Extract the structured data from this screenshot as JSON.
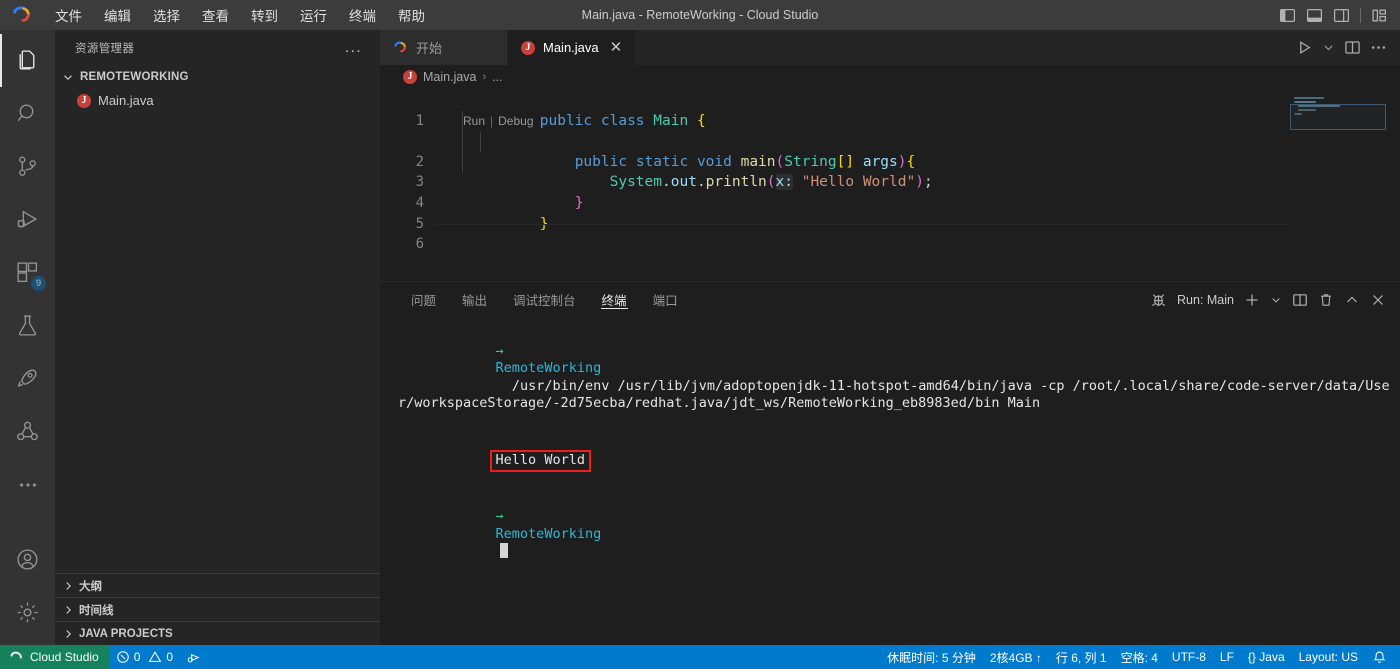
{
  "titlebar": {
    "logo_icon": "cloud-studio-logo-icon",
    "menus": [
      {
        "label": "文件",
        "name": "menu-file"
      },
      {
        "label": "编辑",
        "name": "menu-edit"
      },
      {
        "label": "选择",
        "name": "menu-selection"
      },
      {
        "label": "查看",
        "name": "menu-view"
      },
      {
        "label": "转到",
        "name": "menu-go"
      },
      {
        "label": "运行",
        "name": "menu-run"
      },
      {
        "label": "终端",
        "name": "menu-terminal"
      },
      {
        "label": "帮助",
        "name": "menu-help"
      }
    ],
    "title": "Main.java - RemoteWorking - Cloud Studio",
    "layout_controls": [
      {
        "name": "toggle-primary-sidebar-icon"
      },
      {
        "name": "toggle-panel-icon"
      },
      {
        "name": "toggle-secondary-sidebar-icon"
      },
      {
        "name": "customize-layout-icon"
      }
    ]
  },
  "activitybar": {
    "items": [
      {
        "name": "activity-explorer",
        "icon": "files-icon",
        "active": true,
        "badge": ""
      },
      {
        "name": "activity-search",
        "icon": "search-icon",
        "active": false,
        "badge": ""
      },
      {
        "name": "activity-source-control",
        "icon": "source-control-icon",
        "active": false,
        "badge": ""
      },
      {
        "name": "activity-run-debug",
        "icon": "run-debug-icon",
        "active": false,
        "badge": ""
      },
      {
        "name": "activity-extensions",
        "icon": "extensions-icon",
        "active": false,
        "badge": "9"
      },
      {
        "name": "activity-testing",
        "icon": "beaker-icon",
        "active": false,
        "badge": ""
      },
      {
        "name": "activity-deploy",
        "icon": "rocket-icon",
        "active": false,
        "badge": ""
      },
      {
        "name": "activity-share",
        "icon": "share-nodes-icon",
        "active": false,
        "badge": ""
      },
      {
        "name": "activity-more",
        "icon": "ellipsis-icon",
        "active": false,
        "badge": ""
      }
    ],
    "bottom": [
      {
        "name": "activity-accounts",
        "icon": "account-icon"
      },
      {
        "name": "activity-settings",
        "icon": "gear-icon"
      }
    ]
  },
  "sidebar": {
    "header_title": "资源管理器",
    "more_actions": "...",
    "root_folder": "REMOTEWORKING",
    "files": [
      {
        "name": "Main.java",
        "icon_letter": "J"
      }
    ],
    "sections": [
      {
        "label": "大纲",
        "name": "sidebar-section-outline"
      },
      {
        "label": "时间线",
        "name": "sidebar-section-timeline"
      },
      {
        "label": "JAVA PROJECTS",
        "name": "sidebar-section-java-projects"
      }
    ]
  },
  "editor": {
    "tabs": [
      {
        "label": "开始",
        "name": "tab-welcome",
        "active": false,
        "icon": "cloud-studio-logo-icon",
        "closable": false
      },
      {
        "label": "Main.java",
        "name": "tab-main-java",
        "active": true,
        "icon": "java-file-icon",
        "closable": true
      }
    ],
    "tab_actions": [
      {
        "name": "run-code-button",
        "icon": "play-icon"
      },
      {
        "name": "run-options-chevron-icon",
        "icon": "chevron-down-icon"
      },
      {
        "name": "split-editor-button",
        "icon": "split-editor-icon"
      },
      {
        "name": "editor-more-actions-button",
        "icon": "ellipsis-icon"
      }
    ],
    "breadcrumb": {
      "file": "Main.java",
      "separator": "›",
      "ellipsis": "..."
    },
    "codelens": {
      "run": "Run",
      "divider": "|",
      "debug": "Debug"
    },
    "lines": [
      {
        "number": "1",
        "text": "public class Main {"
      },
      {
        "number": "2",
        "text": "    public static void main(String[] args){"
      },
      {
        "number": "3",
        "text": "        System.out.println(x: \"Hello World\");"
      },
      {
        "number": "4",
        "text": "    }"
      },
      {
        "number": "5",
        "text": "}"
      },
      {
        "number": "6",
        "text": ""
      }
    ],
    "param_hint": "x:",
    "string_literal": "\"Hello World\""
  },
  "panel": {
    "tabs": [
      {
        "label": "问题",
        "name": "panel-tab-problems",
        "active": false
      },
      {
        "label": "输出",
        "name": "panel-tab-output",
        "active": false
      },
      {
        "label": "调试控制台",
        "name": "panel-tab-debug-console",
        "active": false
      },
      {
        "label": "终端",
        "name": "panel-tab-terminal",
        "active": true
      },
      {
        "label": "端口",
        "name": "panel-tab-ports",
        "active": false
      }
    ],
    "terminal_selector_label": "Run: Main",
    "actions": [
      {
        "name": "new-terminal-button",
        "icon": "plus-icon"
      },
      {
        "name": "terminal-profile-chevron-icon",
        "icon": "chevron-down-icon"
      },
      {
        "name": "split-terminal-button",
        "icon": "split-icon"
      },
      {
        "name": "kill-terminal-button",
        "icon": "trash-icon"
      },
      {
        "name": "maximize-panel-button",
        "icon": "chevron-up-icon"
      },
      {
        "name": "close-panel-button",
        "icon": "close-icon"
      }
    ],
    "terminal": {
      "prompt_arrow": "→",
      "prompt_dir": "RemoteWorking",
      "command": "/usr/bin/env /usr/lib/jvm/adoptopenjdk-11-hotspot-amd64/bin/java -cp /root/.local/share/code-server/data/User/workspaceStorage/-2d75ecba/redhat.java/jdt_ws/RemoteWorking_eb8983ed/bin Main",
      "output": "Hello World",
      "highlight_color": "#f01d1d"
    }
  },
  "statusbar": {
    "remote_label": "Cloud Studio",
    "remote_icon": "remote-indicator-icon",
    "errors_icon": "error-icon",
    "errors": "0",
    "warnings_icon": "warning-icon",
    "warnings": "0",
    "ports_icon": "ports-forwarded-icon",
    "right_items": [
      {
        "label": "休眠时间: 5 分钟",
        "name": "status-hibernate-time"
      },
      {
        "label": "2核4GB ↑",
        "name": "status-machine-spec"
      },
      {
        "label": "行 6, 列 1",
        "name": "status-cursor-position"
      },
      {
        "label": "空格: 4",
        "name": "status-indentation"
      },
      {
        "label": "UTF-8",
        "name": "status-encoding"
      },
      {
        "label": "LF",
        "name": "status-eol"
      },
      {
        "label": "{} Java",
        "name": "status-language-mode"
      },
      {
        "label": "Layout: US",
        "name": "status-keyboard-layout"
      }
    ],
    "bell_icon": "bell-icon",
    "accent": "#007acc",
    "remote_accent": "#16825d"
  }
}
